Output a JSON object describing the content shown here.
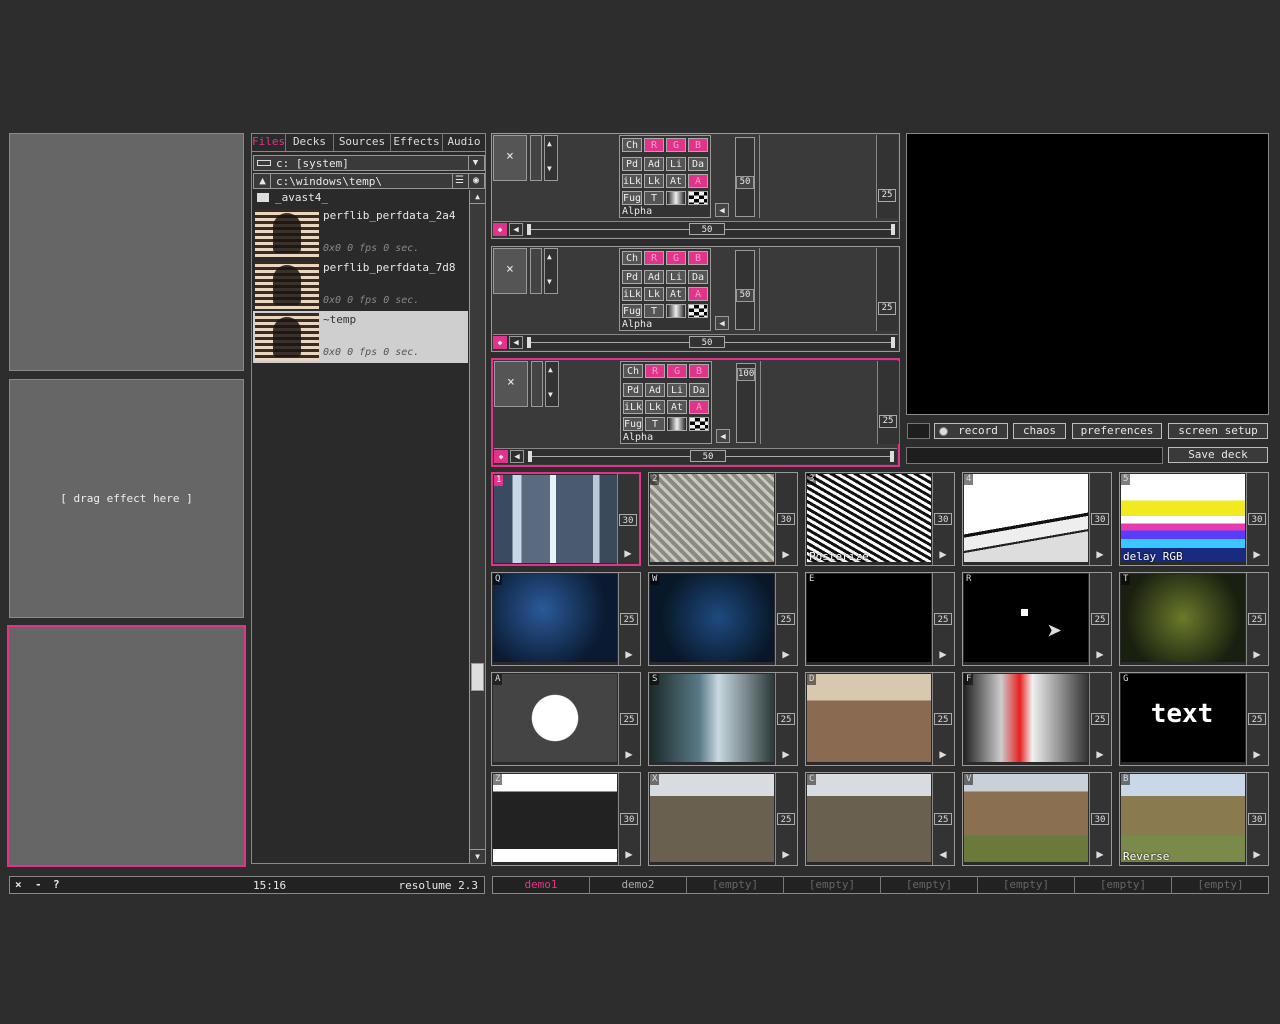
{
  "effects": {
    "drag_hint": "[ drag effect here ]"
  },
  "browser": {
    "tabs": [
      "Files",
      "Decks",
      "Sources",
      "Effects",
      "Audio"
    ],
    "drive": "c: [system]",
    "path": "c:\\windows\\temp\\",
    "folder": "_avast4_",
    "files": [
      {
        "name": "perflib_perfdata_2a4",
        "info": "0x0 0 fps 0 sec."
      },
      {
        "name": "perflib_perfdata_7d8",
        "info": "0x0 0 fps 0 sec."
      },
      {
        "name": "~temp",
        "info": "0x0 0 fps 0 sec."
      }
    ]
  },
  "layers": [
    {
      "ch": "Ch",
      "r": "R",
      "g": "G",
      "b": "B",
      "row2": [
        "Pd",
        "Ad",
        "Li",
        "Da"
      ],
      "row3": [
        "iLk",
        "Lk",
        "At",
        "A"
      ],
      "row4": [
        "Fug",
        "T"
      ],
      "mode": "Alpha",
      "level": "50",
      "opacity": "50",
      "speed": "25"
    },
    {
      "ch": "Ch",
      "r": "R",
      "g": "G",
      "b": "B",
      "row2": [
        "Pd",
        "Ad",
        "Li",
        "Da"
      ],
      "row3": [
        "iLk",
        "Lk",
        "At",
        "A"
      ],
      "row4": [
        "Fug",
        "T"
      ],
      "mode": "Alpha",
      "level": "50",
      "opacity": "50",
      "speed": "25"
    },
    {
      "ch": "Ch",
      "r": "R",
      "g": "G",
      "b": "B",
      "row2": [
        "Pd",
        "Ad",
        "Li",
        "Da"
      ],
      "row3": [
        "iLk",
        "Lk",
        "At",
        "A"
      ],
      "row4": [
        "Fug",
        "T"
      ],
      "mode": "Alpha",
      "level": "100",
      "opacity": "50",
      "speed": "25"
    }
  ],
  "output": {
    "record": "record",
    "chaos": "chaos",
    "preferences": "preferences",
    "screen_setup": "screen setup",
    "save_deck": "Save deck"
  },
  "clips": [
    {
      "key": "1",
      "speed": "30",
      "title": ""
    },
    {
      "key": "2",
      "speed": "30",
      "title": ""
    },
    {
      "key": "3",
      "speed": "30",
      "title": "Posterize"
    },
    {
      "key": "4",
      "speed": "30",
      "title": ""
    },
    {
      "key": "5",
      "speed": "30",
      "title": "delay RGB"
    },
    {
      "key": "Q",
      "speed": "25",
      "title": ""
    },
    {
      "key": "W",
      "speed": "25",
      "title": ""
    },
    {
      "key": "E",
      "speed": "25",
      "title": ""
    },
    {
      "key": "R",
      "speed": "25",
      "title": ""
    },
    {
      "key": "T",
      "speed": "25",
      "title": ""
    },
    {
      "key": "A",
      "speed": "25",
      "title": ""
    },
    {
      "key": "S",
      "speed": "25",
      "title": ""
    },
    {
      "key": "D",
      "speed": "25",
      "title": ""
    },
    {
      "key": "F",
      "speed": "25",
      "title": ""
    },
    {
      "key": "G",
      "speed": "25",
      "title": "",
      "text": "text"
    },
    {
      "key": "Z",
      "speed": "30",
      "title": ""
    },
    {
      "key": "X",
      "speed": "25",
      "title": ""
    },
    {
      "key": "C",
      "speed": "25",
      "title": ""
    },
    {
      "key": "V",
      "speed": "30",
      "title": ""
    },
    {
      "key": "B",
      "speed": "30",
      "title": "Reverse"
    }
  ],
  "status": {
    "close": "×",
    "minimize": "-",
    "help": "?",
    "time": "15:16",
    "app": "resolume 2.3"
  },
  "decks": [
    "demo1",
    "demo2",
    "[empty]",
    "[empty]",
    "[empty]",
    "[empty]",
    "[empty]",
    "[empty]"
  ]
}
